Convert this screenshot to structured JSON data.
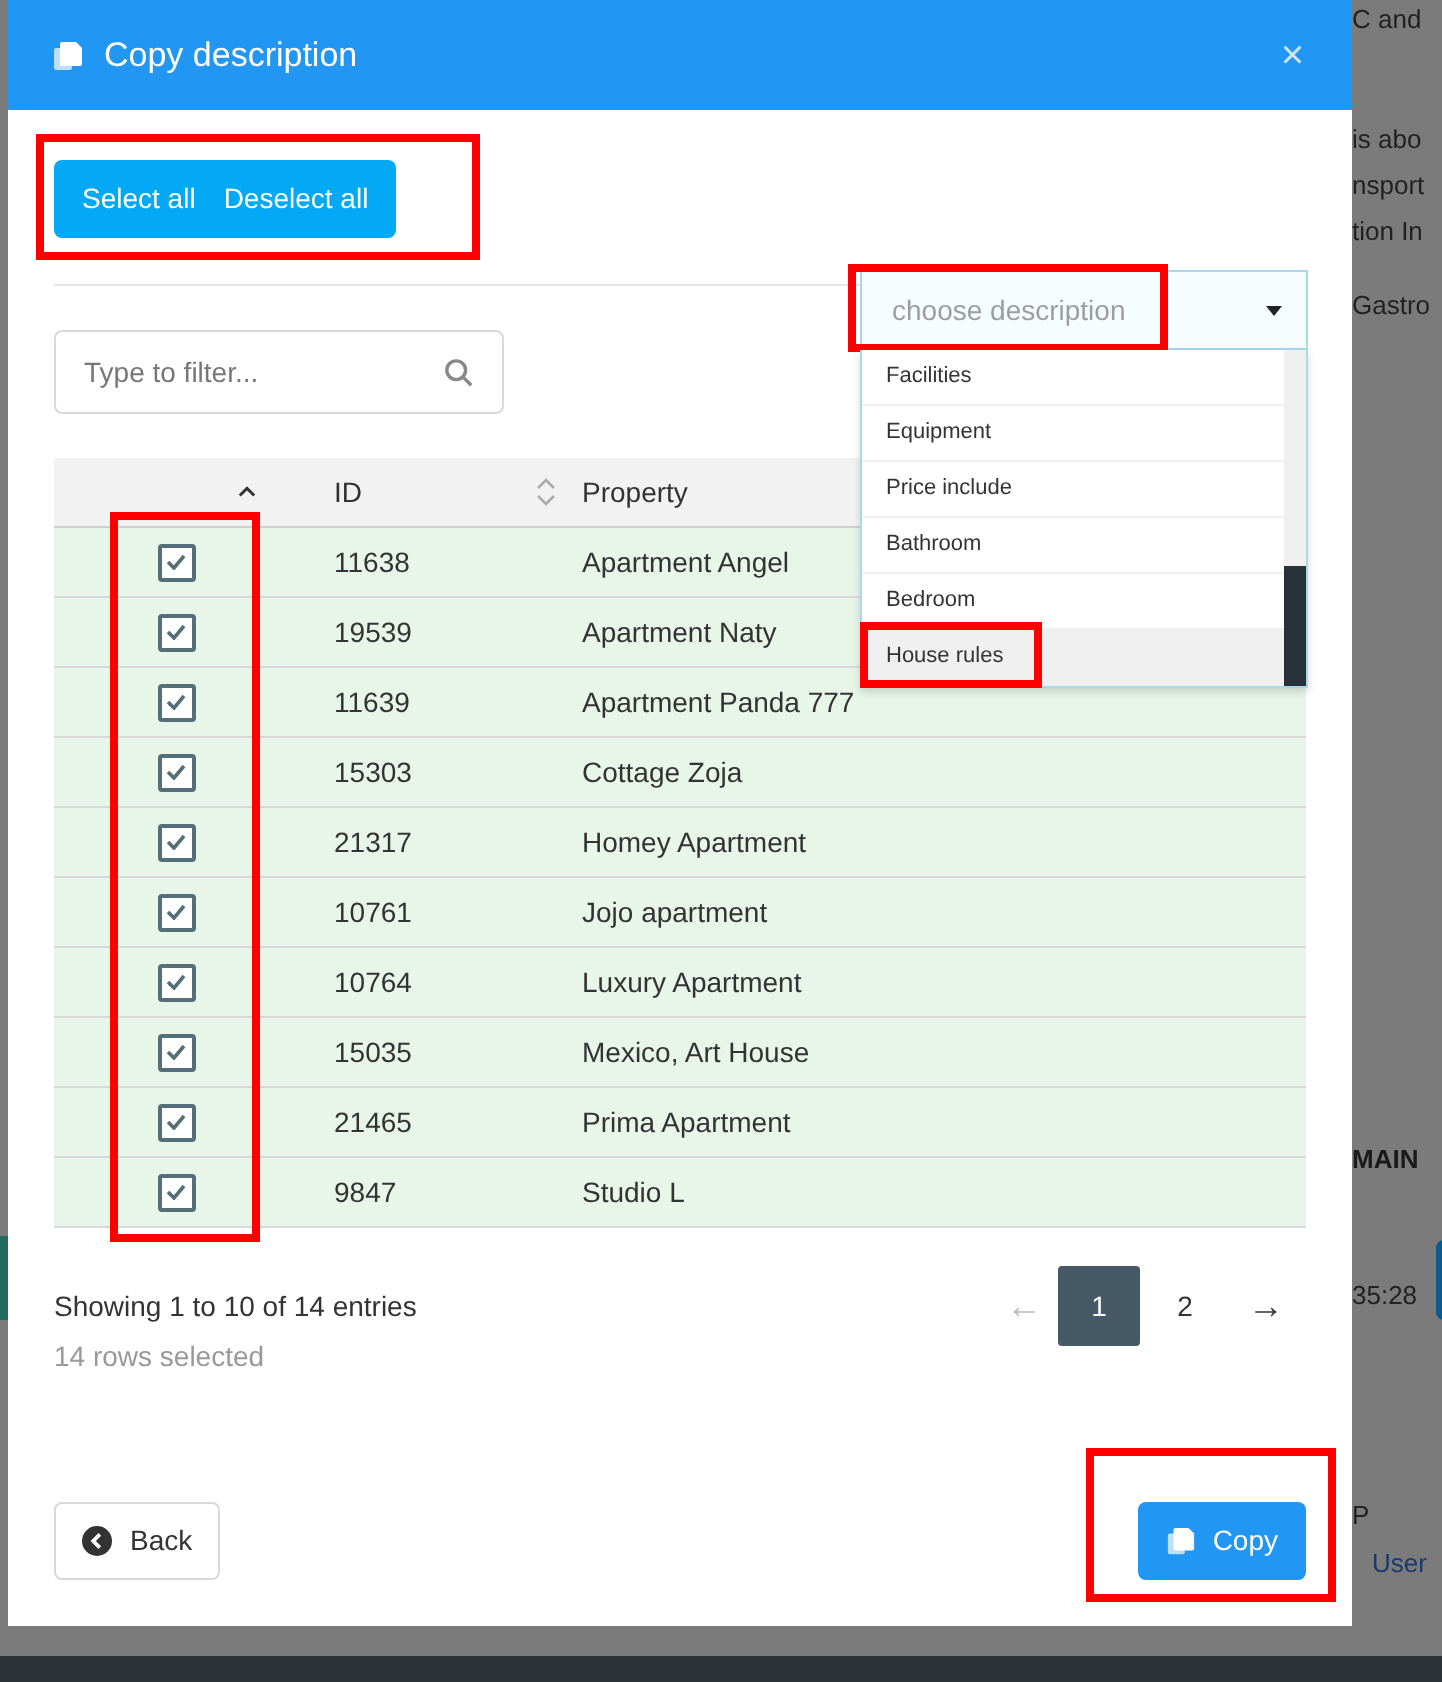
{
  "background_texts": [
    {
      "text": "C and",
      "kind": "plain"
    },
    {
      "text": "is abo",
      "kind": "plain"
    },
    {
      "text": "nsport",
      "kind": "plain"
    },
    {
      "text": "tion In",
      "kind": "plain"
    },
    {
      "text": "Gastro",
      "kind": "plain"
    },
    {
      "text": "MAIN",
      "kind": "heading"
    },
    {
      "text": "35:28",
      "kind": "plain"
    },
    {
      "text": "P",
      "kind": "plain"
    },
    {
      "text": "User",
      "kind": "link"
    }
  ],
  "dialog": {
    "title": "Copy description",
    "close": "×"
  },
  "select_buttons": {
    "highlighted": true,
    "buttons": [
      "Select all",
      "Deselect all"
    ]
  },
  "description_select": {
    "placeholder": "choose description",
    "highlighted": true,
    "expanded": true,
    "options": [
      {
        "label": "Facilities",
        "selected": false,
        "highlighted": false
      },
      {
        "label": "Equipment",
        "selected": false,
        "highlighted": false
      },
      {
        "label": "Price include",
        "selected": false,
        "highlighted": false
      },
      {
        "label": "Bathroom",
        "selected": false,
        "highlighted": false
      },
      {
        "label": "Bedroom",
        "selected": false,
        "highlighted": false
      },
      {
        "label": "House rules",
        "selected": true,
        "highlighted": true
      }
    ]
  },
  "filter": {
    "placeholder": "Type to filter..."
  },
  "table": {
    "columns": [
      "ID",
      "Property"
    ],
    "checkbox_column_highlighted": true,
    "rows": [
      {
        "checked": true,
        "id": "11638",
        "property": "Apartment Angel"
      },
      {
        "checked": true,
        "id": "19539",
        "property": "Apartment Naty"
      },
      {
        "checked": true,
        "id": "11639",
        "property": "Apartment Panda 777"
      },
      {
        "checked": true,
        "id": "15303",
        "property": "Cottage Zoja"
      },
      {
        "checked": true,
        "id": "21317",
        "property": "Homey Apartment"
      },
      {
        "checked": true,
        "id": "10761",
        "property": "Jojo apartment"
      },
      {
        "checked": true,
        "id": "10764",
        "property": "Luxury Apartment"
      },
      {
        "checked": true,
        "id": "15035",
        "property": "Mexico, Art House"
      },
      {
        "checked": true,
        "id": "21465",
        "property": "Prima Apartment"
      },
      {
        "checked": true,
        "id": "9847",
        "property": "Studio L"
      }
    ]
  },
  "pagination": {
    "info": "Showing 1 to 10 of 14 entries",
    "selected_info": "14 rows selected",
    "prev": "←",
    "prev_disabled": true,
    "pages": [
      {
        "label": "1",
        "selected": true
      },
      {
        "label": "2",
        "selected": false
      }
    ],
    "next": "→"
  },
  "footer": {
    "back": "Back",
    "copy": {
      "label": "Copy",
      "highlighted": true
    }
  }
}
